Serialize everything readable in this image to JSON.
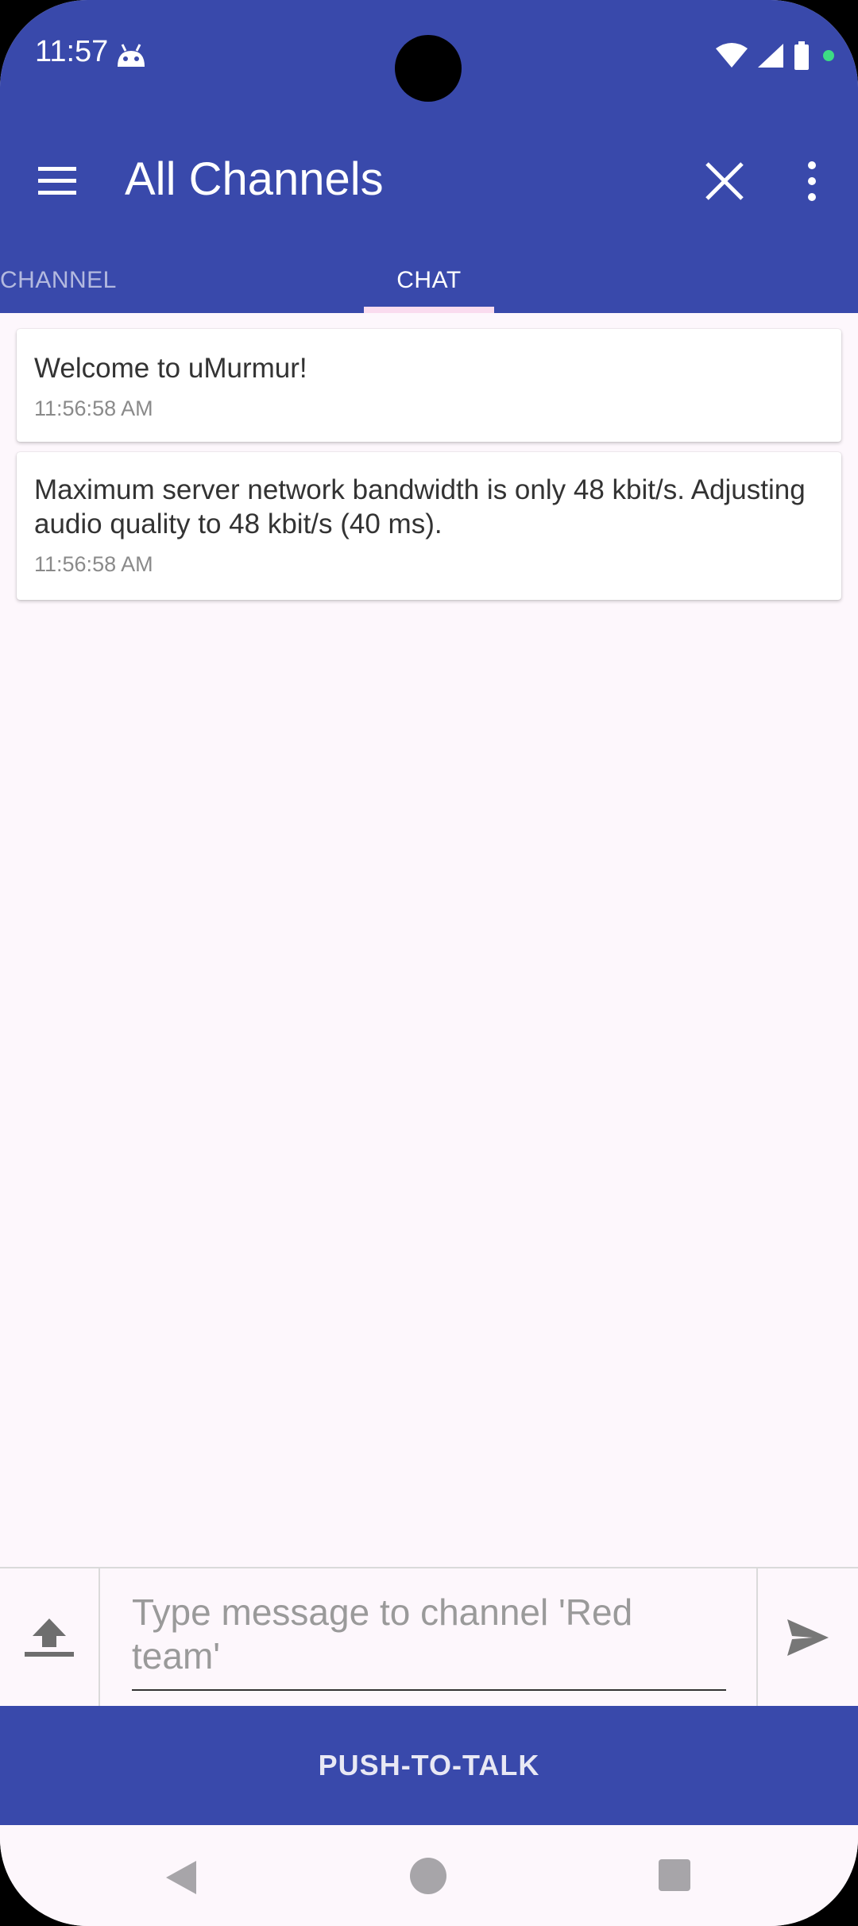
{
  "status_bar": {
    "time": "11:57"
  },
  "app_bar": {
    "title": "All Channels"
  },
  "tabs": [
    {
      "label": "CHANNEL",
      "selected": false
    },
    {
      "label": "CHAT",
      "selected": true
    }
  ],
  "messages": [
    {
      "text": "Welcome to uMurmur!",
      "time": "11:56:58 AM"
    },
    {
      "text": "Maximum server network bandwidth is only 48 kbit/s. Adjusting audio quality to 48 kbit/s (40 ms).",
      "time": "11:56:58 AM"
    }
  ],
  "composer": {
    "placeholder": "Type message to channel 'Red team'"
  },
  "push_to_talk": {
    "label": "PUSH-TO-TALK"
  },
  "colors": {
    "primary": "#3949AB",
    "background": "#FDF7FC",
    "tab_indicator": "#FADCEF",
    "status_dot": "#3DDC84"
  },
  "icons": {
    "menu": "hamburger-icon",
    "close": "close-icon",
    "more": "more-vert-icon",
    "upload": "upload-icon",
    "send": "send-icon"
  }
}
